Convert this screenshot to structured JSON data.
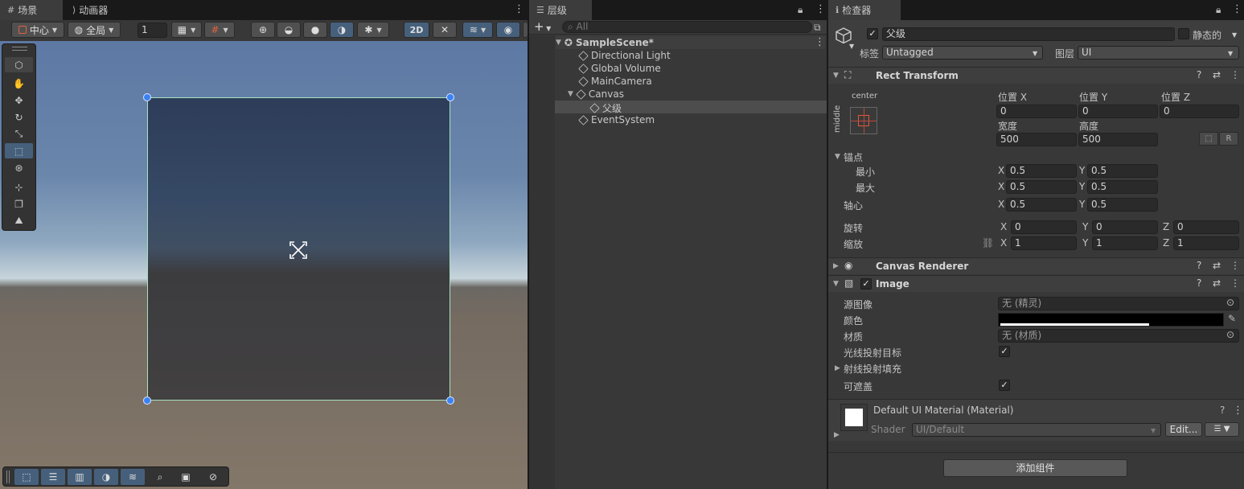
{
  "scene_tabs": {
    "scene": "场景",
    "animator": "动画器"
  },
  "scene_toolbar": {
    "pivot": "中心",
    "space": "全局",
    "grid_size": "1",
    "mode_2d": "2D"
  },
  "scene_tools": [
    "hand-tool",
    "move-tool",
    "rotate-tool",
    "scale-tool",
    "rect-tool",
    "transform-tool",
    "custom-tool-a",
    "custom-tool-b",
    "custom-tool-c"
  ],
  "hierarchy": {
    "tab": "层级",
    "search_placeholder": "All",
    "scene_name": "SampleScene*",
    "items": [
      {
        "label": "Directional Light"
      },
      {
        "label": "Global Volume"
      },
      {
        "label": "MainCamera"
      },
      {
        "label": "Canvas"
      },
      {
        "label": "父级"
      },
      {
        "label": "EventSystem"
      }
    ]
  },
  "inspector": {
    "tab": "检查器",
    "object_name": "父级",
    "static_label": "静态的",
    "tag_label": "标签",
    "tag_value": "Untagged",
    "layer_label": "图层",
    "layer_value": "UI",
    "rect_transform": {
      "title": "Rect Transform",
      "anchor_h": "center",
      "anchor_v": "middle",
      "pos_x_label": "位置 X",
      "pos_y_label": "位置 Y",
      "pos_z_label": "位置 Z",
      "pos_x": "0",
      "pos_y": "0",
      "pos_z": "0",
      "width_label": "宽度",
      "height_label": "高度",
      "width": "500",
      "height": "500",
      "r_label": "R",
      "anchors_label": "锚点",
      "min_label": "最小",
      "max_label": "最大",
      "min_x": "0.5",
      "min_y": "0.5",
      "max_x": "0.5",
      "max_y": "0.5",
      "pivot_label": "轴心",
      "pivot_x": "0.5",
      "pivot_y": "0.5",
      "rotation_label": "旋转",
      "rot_x": "0",
      "rot_y": "0",
      "rot_z": "0",
      "scale_label": "缩放",
      "scale_x": "1",
      "scale_y": "1",
      "scale_z": "1",
      "x": "X",
      "y": "Y",
      "z": "Z"
    },
    "canvas_renderer": {
      "title": "Canvas Renderer"
    },
    "image": {
      "title": "Image",
      "source_label": "源图像",
      "source_value": "无 (精灵)",
      "color_label": "颜色",
      "material_label": "材质",
      "material_value": "无 (材质)",
      "raycast_label": "光线投射目标",
      "raycast_padding_label": "射线投射填充",
      "maskable_label": "可遮盖"
    },
    "material": {
      "title": "Default UI Material (Material)",
      "shader_label": "Shader",
      "shader_value": "UI/Default",
      "edit_label": "Edit..."
    },
    "add_component": "添加组件"
  },
  "colors": {
    "accent": "#46607c",
    "selection_outline": "#a8e0c0",
    "handle": "#3b82f6",
    "panel": "#383838",
    "header": "#3e3e3e"
  }
}
